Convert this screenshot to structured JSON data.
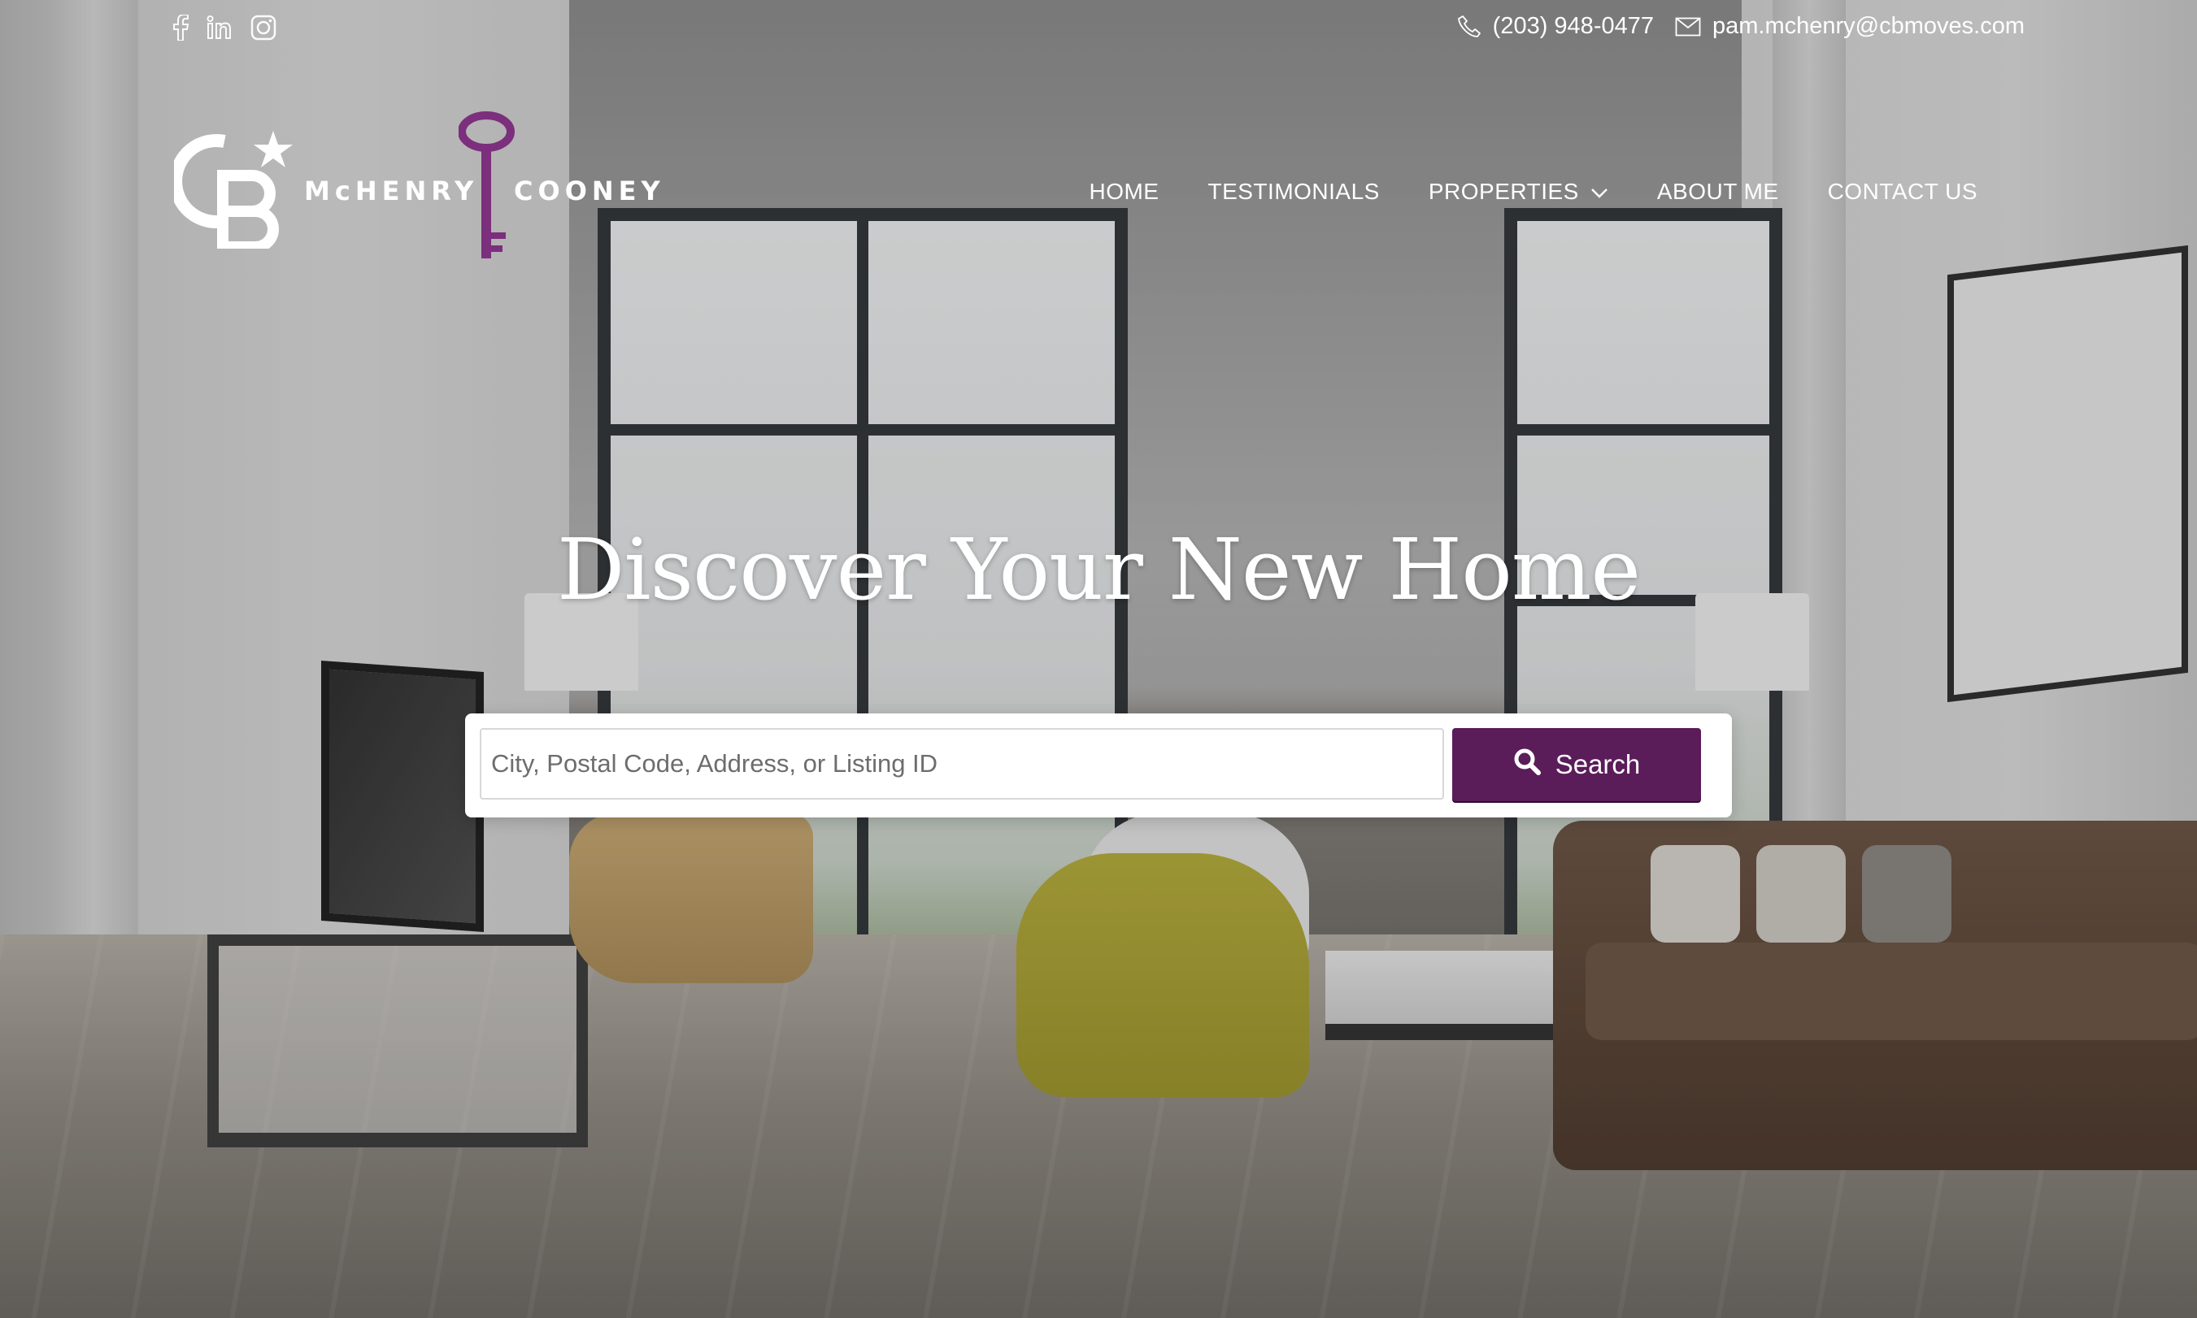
{
  "colors": {
    "brand_purple": "#5b1c5a",
    "text_white": "#ffffff",
    "search_border": "#d8d8d8"
  },
  "social": [
    {
      "name": "facebook",
      "icon": "facebook-icon",
      "glyph": "f"
    },
    {
      "name": "linkedin",
      "icon": "linkedin-icon",
      "glyph": "in"
    },
    {
      "name": "instagram",
      "icon": "instagram-icon",
      "glyph": "◎"
    }
  ],
  "contact": {
    "phone": "(203) 948-0477",
    "phone_icon": "phone-icon",
    "email": "pam.mchenry@cbmoves.com",
    "email_icon": "envelope-icon"
  },
  "logo": {
    "mark_icon": "coldwell-banker-logo-icon",
    "word_left": "McHENRY",
    "word_right": "COONEY",
    "key_icon": "key-icon"
  },
  "nav": {
    "items": [
      {
        "label": "HOME"
      },
      {
        "label": "TESTIMONIALS"
      },
      {
        "label": "PROPERTIES",
        "has_dropdown": true,
        "dropdown_icon": "chevron-down-icon"
      },
      {
        "label": "ABOUT ME"
      },
      {
        "label": "CONTACT US"
      }
    ]
  },
  "hero": {
    "title": "Discover Your New Home"
  },
  "search": {
    "placeholder": "City, Postal Code, Address, or Listing ID",
    "value": "",
    "button_label": "Search",
    "button_icon": "search-icon"
  }
}
